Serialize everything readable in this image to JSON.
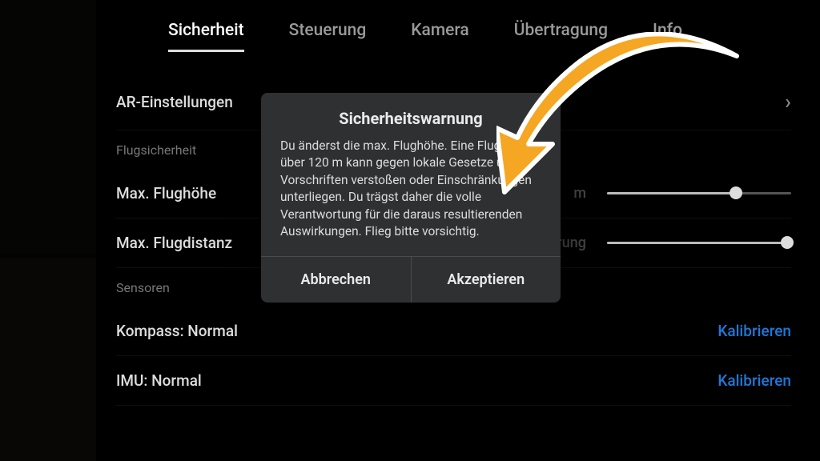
{
  "tabs": {
    "items": [
      "Sicherheit",
      "Steuerung",
      "Kamera",
      "Übertragung",
      "Info"
    ],
    "active_index": 0
  },
  "settings": {
    "ar_row_label": "AR-Einstellungen",
    "section_flugsicherheit": "Flugsicherheit",
    "max_flughoehe_label": "Max. Flughöhe",
    "max_flughoehe_value_hint": "m",
    "max_flugdistanz_label": "Max. Flugdistanz",
    "max_flugdistanz_value_hint": "Keine Limitierung",
    "section_sensoren": "Sensoren",
    "kompass_label": "Kompass: Normal",
    "imu_label": "IMU: Normal",
    "calibrate_label": "Kalibrieren"
  },
  "modal": {
    "title": "Sicherheitswarnung",
    "body": "Du änderst die max. Flughöhe. Eine Flughöhe über 120 m kann gegen lokale Gesetze und Vorschriften verstoßen oder Einschränkungen unterliegen. Du trägst daher die volle Verantwortung für die daraus resultierenden Auswirkungen. Flieg bitte vorsichtig.",
    "cancel": "Abbrechen",
    "accept": "Akzeptieren"
  }
}
